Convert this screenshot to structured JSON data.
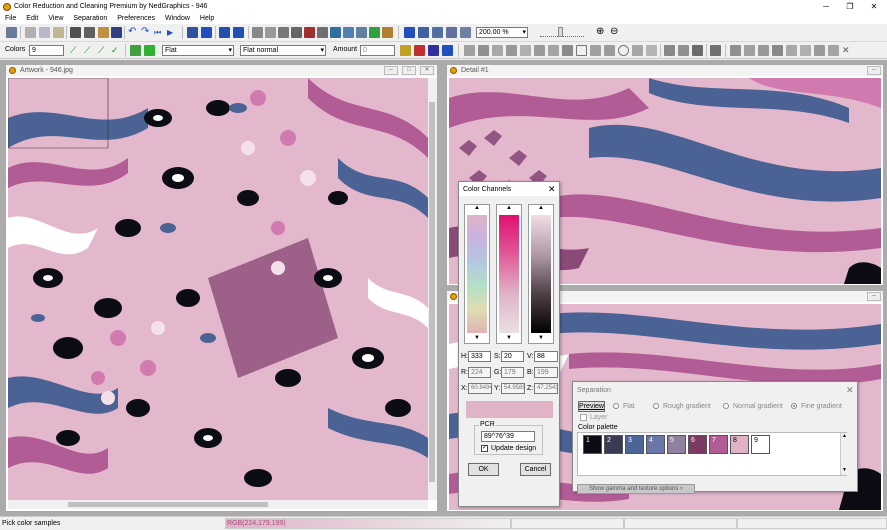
{
  "app": {
    "title": "Color Reduction and Cleaning Premium by NedGraphics - 946",
    "window_controls": [
      "─",
      "❐",
      "✕"
    ]
  },
  "menu": [
    "File",
    "Edit",
    "View",
    "Separation",
    "Preferences",
    "Window",
    "Help"
  ],
  "toolbar": {
    "zoom_value": "200.00 %"
  },
  "colorbar": {
    "colors_label": "Colors",
    "colors_value": "9",
    "mode_value": "Flat",
    "normal_value": "Flat normal",
    "amount_label": "Amount",
    "amount_value": "0"
  },
  "artwork": {
    "title": "Artwork - 946.jpg"
  },
  "detail": {
    "title": "Detail #1"
  },
  "color_channels": {
    "title": "Color Channels",
    "h_label": "H:",
    "h_value": "333",
    "s_label": "S:",
    "s_value": "20",
    "v_label": "V:",
    "v_value": "88",
    "r_label": "R:",
    "r_value": "224",
    "g_label": "G:",
    "g_value": "179",
    "b_label": "B:",
    "b_value": "199",
    "x_label": "X:",
    "x_value": "60.8494",
    "y_label": "Y:",
    "y_value": "54.9588",
    "z_label": "Z:",
    "z_value": "47.2543",
    "pcr_label": "PCR",
    "pcr_value": "89^76^39",
    "update_label": "Update design",
    "ok_label": "OK",
    "cancel_label": "Cancel",
    "preview_color": "#e0b3c7"
  },
  "separation": {
    "title": "Separation",
    "preview_label": "Preview",
    "flat_label": "Flat",
    "rough_label": "Rough gradient",
    "normal_label": "Normal gradient",
    "fine_label": "Fine gradient",
    "layer_label": "Layer",
    "palette_label": "Color palette",
    "more_label": "Show gamma and texture options",
    "palette": [
      {
        "num": "1",
        "color": "#0c0c14"
      },
      {
        "num": "2",
        "color": "#3a3a54"
      },
      {
        "num": "3",
        "color": "#4c6496"
      },
      {
        "num": "4",
        "color": "#6a76a8"
      },
      {
        "num": "5",
        "color": "#90809e"
      },
      {
        "num": "6",
        "color": "#7a3a62"
      },
      {
        "num": "7",
        "color": "#b25c96"
      },
      {
        "num": "8",
        "color": "#e0b3c7"
      },
      {
        "num": "9",
        "color": "#ffffff"
      }
    ]
  },
  "status": {
    "hint": "Pick color samples",
    "rgb": "RGB(224,179,199)"
  }
}
